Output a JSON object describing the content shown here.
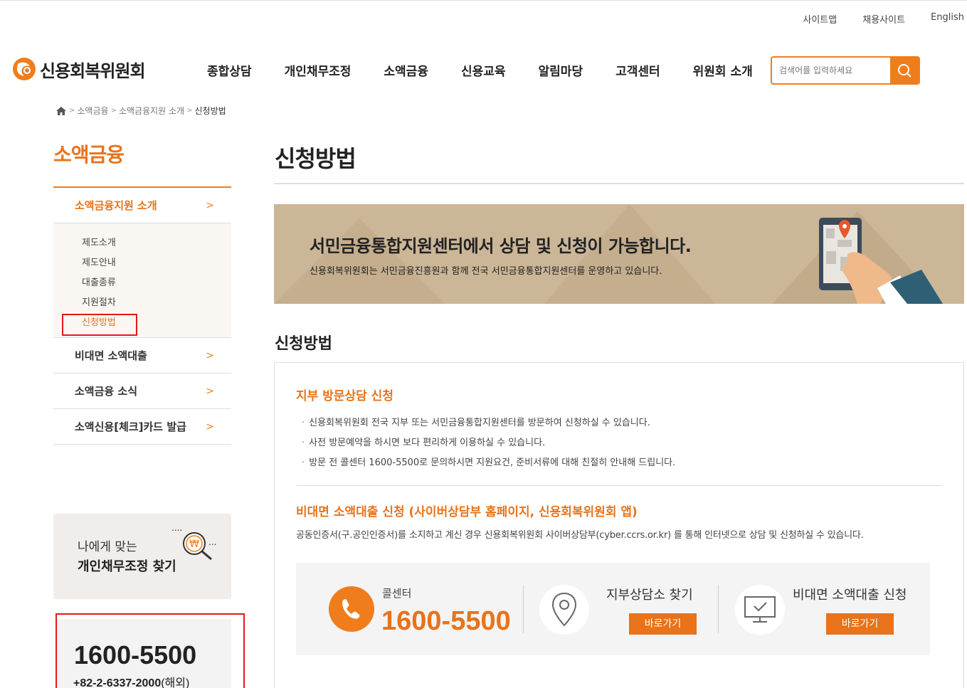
{
  "util": {
    "sitemap": "사이트맵",
    "recruit": "채용사이트",
    "english": "English"
  },
  "logo": {
    "text": "신용회복위원회"
  },
  "gnb": [
    "종합상담",
    "개인채무조정",
    "소액금융",
    "신용교육",
    "알림마당",
    "고객센터",
    "위원회 소개"
  ],
  "search": {
    "placeholder": "검색어를 입력하세요"
  },
  "breadcrumb": [
    "소액금융",
    "소액금융지원 소개",
    "신청방법"
  ],
  "sidebar": {
    "title": "소액금융",
    "items": [
      {
        "label": "소액금융지원 소개"
      },
      {
        "label": "비대면 소액대출"
      },
      {
        "label": "소액금융 소식"
      },
      {
        "label": "소액신용[체크]카드 발급"
      }
    ],
    "sub": [
      "제도소개",
      "제도안내",
      "대출종류",
      "지원절차",
      "신청방법"
    ],
    "find": {
      "line1": "나에게 맞는",
      "line2": "개인채무조정 찾기"
    },
    "phone": {
      "number": "1600-5500",
      "intl": "+82-2-6337-2000",
      "intl_suffix": "(해외)"
    }
  },
  "content": {
    "title": "신청방법",
    "banner": {
      "headline": "서민금융통합지원센터에서 상담 및 신청이 가능합니다.",
      "sub": "신용회복위원회는 서민금융진흥원과 함께 전국 서민금융통합지원센터를 운영하고 있습니다."
    },
    "section_title": "신청방법",
    "visit": {
      "heading": "지부 방문상담 신청",
      "bullets": [
        "신용회복위원회 전국 지부 또는 서민금융통합지원센터를 방문하여 신청하실 수 있습니다.",
        "사전 방문예약을 하시면 보다 편리하게 이용하실 수 있습니다.",
        "방문 전 콜센터 1600-5500로 문의하시면 지원요건, 준비서류에 대해 친절히 안내해 드립니다."
      ]
    },
    "online": {
      "heading": "비대면 소액대출 신청 (사이버상담부 홈페이지, 신용회복위원회 앱)",
      "desc": "공동인증서(구.공인인증서)를 소지하고 계신 경우 신용회복위원회 사이버상담부(cyber.ccrs.or.kr) 를 통해 인터넷으로 상담 및 신청하실 수 있습니다."
    },
    "callbox": {
      "call_label": "콜센터",
      "call_number": "1600-5500",
      "branch_label": "지부상담소 찾기",
      "branch_btn": "바로가기",
      "online_label": "비대면 소액대출 신청",
      "online_btn": "바로가기"
    }
  },
  "colors": {
    "accent": "#f07d1c",
    "highlight_box": "#e31919",
    "banner_bg": "#cbb697"
  }
}
